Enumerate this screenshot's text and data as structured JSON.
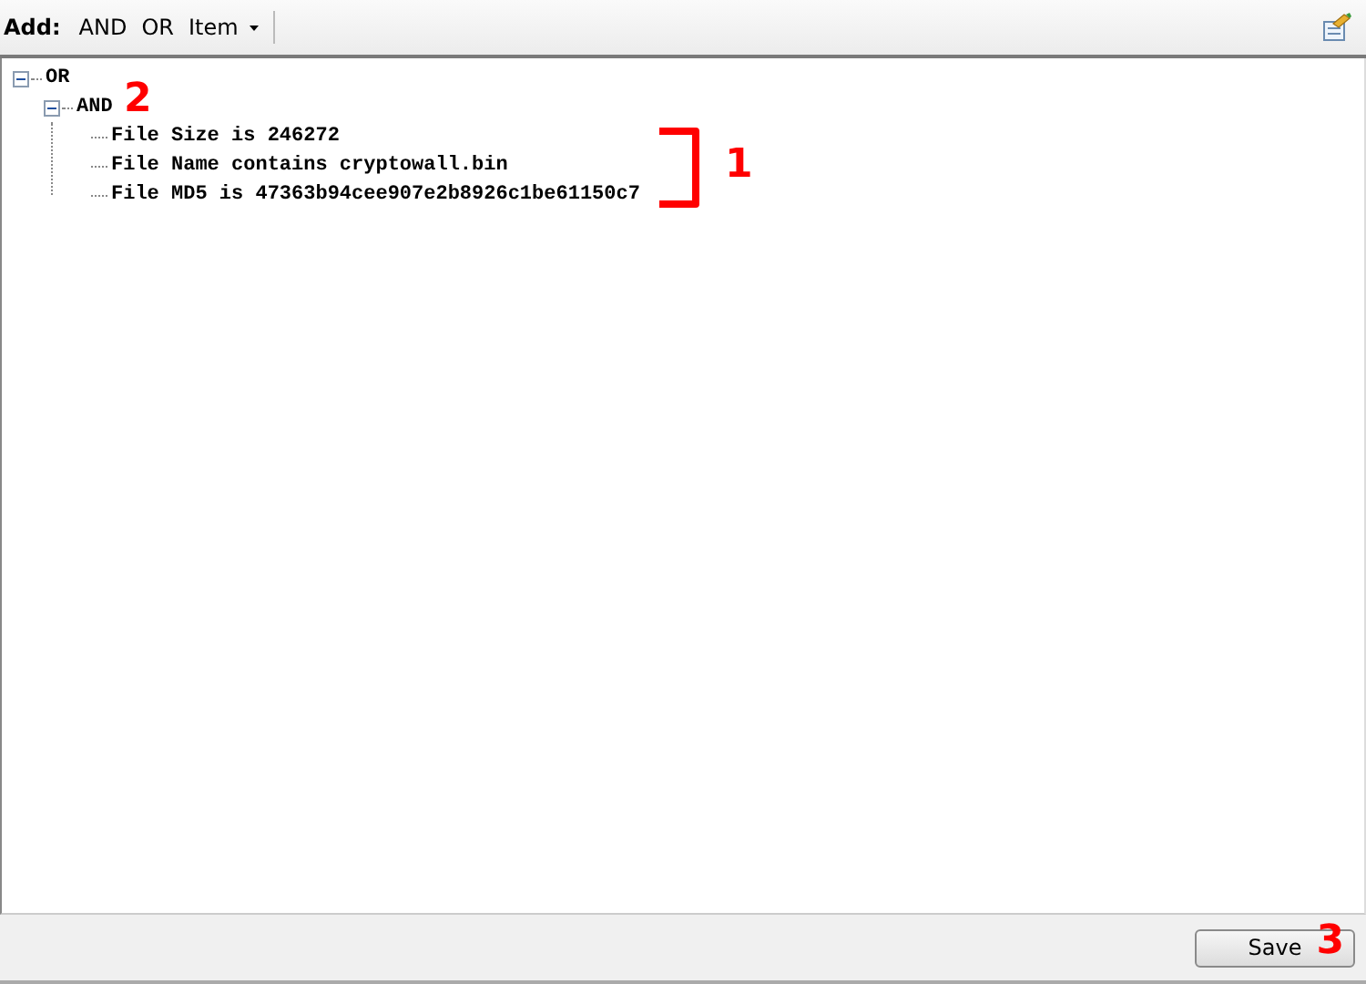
{
  "toolbar": {
    "label": "Add:",
    "items": [
      {
        "label": "AND",
        "kind": "button"
      },
      {
        "label": "OR",
        "kind": "button"
      },
      {
        "label": "Item",
        "kind": "dropdown"
      }
    ]
  },
  "tree": [
    {
      "label": "OR",
      "expanded": true,
      "children": [
        {
          "label": "AND",
          "expanded": true,
          "children": [
            {
              "label": "File Size is 246272"
            },
            {
              "label": "File Name contains cryptowall.bin"
            },
            {
              "label": "File MD5 is 47363b94cee907e2b8926c1be61150c7"
            }
          ]
        }
      ]
    }
  ],
  "annotations": [
    {
      "label": "1",
      "kind": "bracket"
    },
    {
      "label": "2",
      "kind": "number"
    },
    {
      "label": "3",
      "kind": "number"
    }
  ],
  "footer": {
    "button": "Save"
  }
}
